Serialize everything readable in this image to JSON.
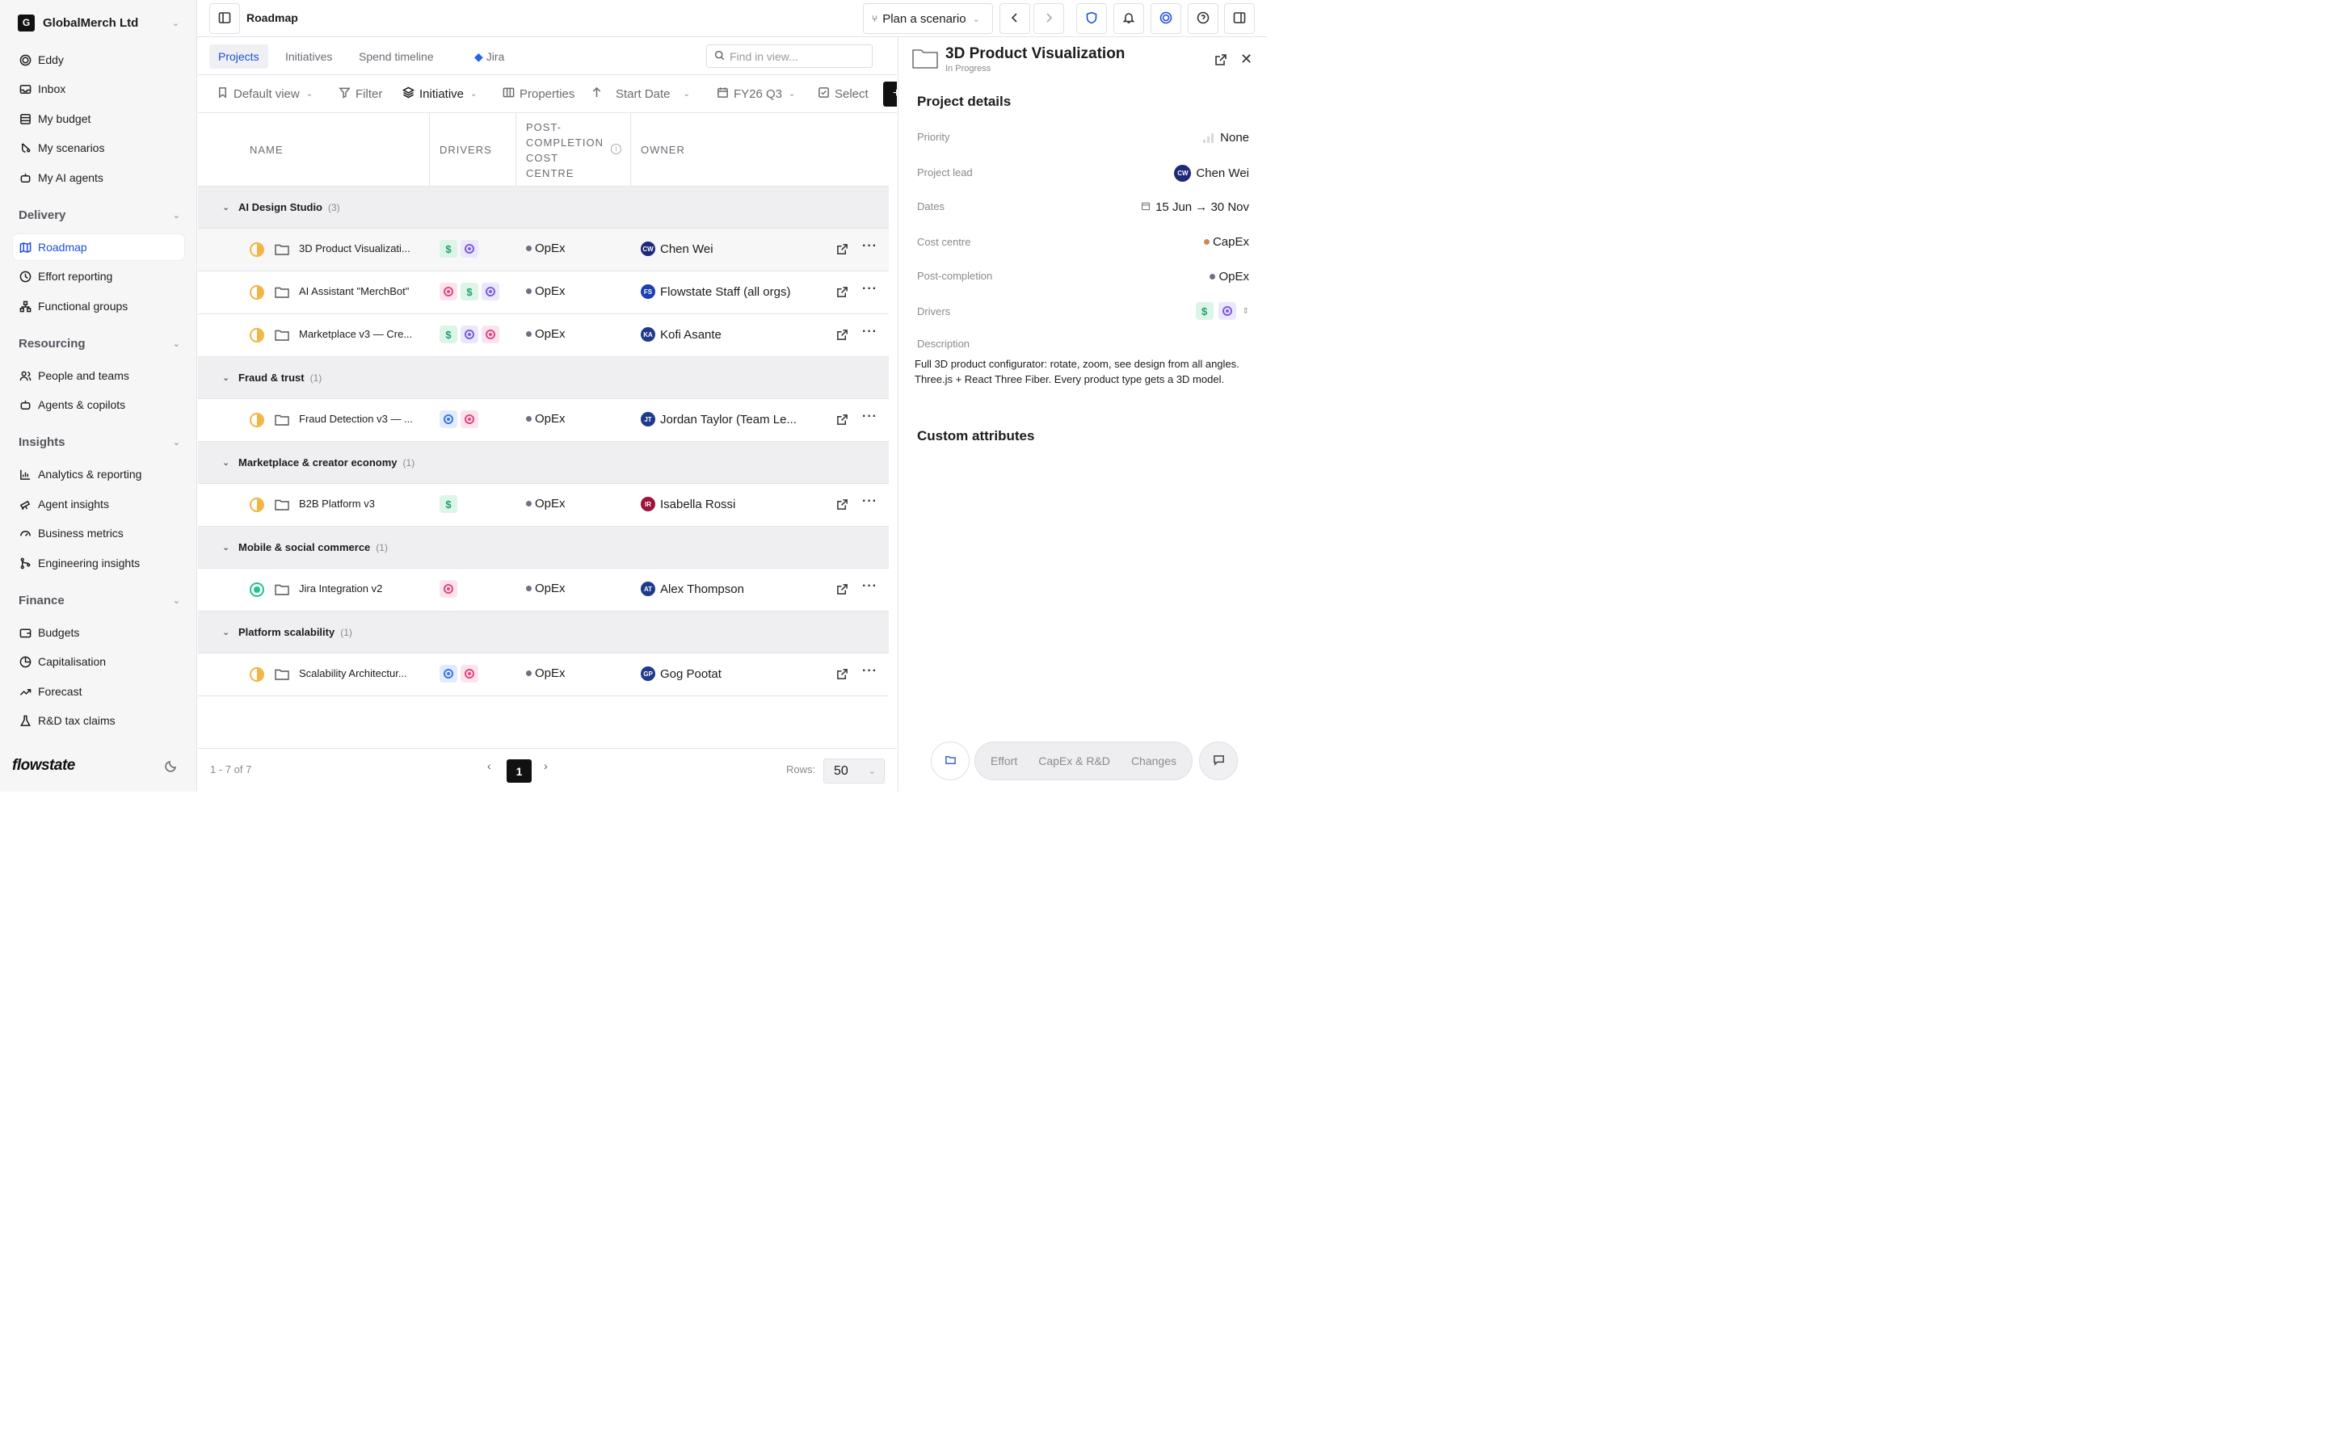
{
  "org": {
    "logo_letter": "G",
    "name": "GlobalMerch Ltd"
  },
  "nav": {
    "top": [
      "Eddy",
      "Inbox",
      "My budget",
      "My scenarios",
      "My AI agents"
    ],
    "delivery": {
      "heading": "Delivery",
      "items": [
        "Roadmap",
        "Effort reporting",
        "Functional groups"
      ]
    },
    "resourcing": {
      "heading": "Resourcing",
      "items": [
        "People and teams",
        "Agents & copilots"
      ]
    },
    "insights": {
      "heading": "Insights",
      "items": [
        "Analytics & reporting",
        "Agent insights",
        "Business metrics",
        "Engineering insights"
      ]
    },
    "finance": {
      "heading": "Finance",
      "items": [
        "Budgets",
        "Capitalisation",
        "Forecast",
        "R&D tax claims"
      ]
    }
  },
  "brand": "flowstate",
  "topbar": {
    "breadcrumb": "Roadmap",
    "plan_label": "Plan a scenario"
  },
  "tabs": [
    "Projects",
    "Initiatives",
    "Spend timeline",
    "Jira"
  ],
  "search": {
    "placeholder": "Find in view..."
  },
  "toolbar": {
    "view": "Default view",
    "filter": "Filter",
    "group": "Initiative",
    "properties": "Properties",
    "sort": "Start Date",
    "period": "FY26 Q3",
    "select": "Select"
  },
  "columns": {
    "name": "NAME",
    "drivers": "DRIVERS",
    "post": "POST-\nCOMPLETION\nCOST\nCENTRE",
    "owner": "OWNER"
  },
  "groups": [
    {
      "name": "AI Design Studio",
      "count": "(3)",
      "rows": [
        {
          "name": "3D Product Visualizati...",
          "drivers": [
            "money",
            "purple"
          ],
          "cost": "OpEx",
          "owner": "Chen Wei",
          "initials": "CW",
          "color": "#1e2a78",
          "status": "half"
        },
        {
          "name": "AI Assistant \"MerchBot\"",
          "drivers": [
            "pink",
            "money",
            "purple"
          ],
          "cost": "OpEx",
          "owner": "Flowstate Staff (all orgs)",
          "initials": "FS",
          "color": "#1e40af",
          "status": "half"
        },
        {
          "name": "Marketplace v3 — Cre...",
          "drivers": [
            "money",
            "purple",
            "pink"
          ],
          "cost": "OpEx",
          "owner": "Kofi Asante",
          "initials": "KA",
          "color": "#1e3a8a",
          "status": "half"
        }
      ]
    },
    {
      "name": "Fraud & trust",
      "count": "(1)",
      "rows": [
        {
          "name": "Fraud Detection v3 — ...",
          "drivers": [
            "blue",
            "pink"
          ],
          "cost": "OpEx",
          "owner": "Jordan Taylor (Team Le...",
          "initials": "JT",
          "color": "#1e3a8a",
          "status": "half"
        }
      ]
    },
    {
      "name": "Marketplace & creator economy",
      "count": "(1)",
      "rows": [
        {
          "name": "B2B Platform v3",
          "drivers": [
            "money"
          ],
          "cost": "OpEx",
          "owner": "Isabella Rossi",
          "initials": "IR",
          "color": "#9f1239",
          "status": "half"
        }
      ]
    },
    {
      "name": "Mobile & social commerce",
      "count": "(1)",
      "rows": [
        {
          "name": "Jira Integration v2",
          "drivers": [
            "pink"
          ],
          "cost": "OpEx",
          "owner": "Alex Thompson",
          "initials": "AT",
          "color": "#1e3a8a",
          "status": "done"
        }
      ]
    },
    {
      "name": "Platform scalability",
      "count": "(1)",
      "rows": [
        {
          "name": "Scalability Architectur...",
          "drivers": [
            "blue",
            "pink"
          ],
          "cost": "OpEx",
          "owner": "Gog Pootat",
          "initials": "GP",
          "color": "#1e3a8a",
          "status": "half"
        }
      ]
    }
  ],
  "pager": {
    "count": "1 - 7 of 7",
    "page": "1",
    "rows_label": "Rows:",
    "rows_value": "50"
  },
  "panel": {
    "title": "3D Product Visualization",
    "status": "In Progress",
    "details_heading": "Project details",
    "priority_label": "Priority",
    "priority_value": "None",
    "lead_label": "Project lead",
    "lead_value": "Chen Wei",
    "lead_initials": "CW",
    "dates_label": "Dates",
    "dates_value": "15 Jun → 30 Nov",
    "cost_label": "Cost centre",
    "cost_value": "CapEx",
    "post_label": "Post-completion",
    "post_value": "OpEx",
    "drivers_label": "Drivers",
    "desc_label": "Description",
    "description": "Full 3D product configurator: rotate, zoom, see design from all angles. Three.js + React Three Fiber. Every product type gets a 3D model.",
    "custom_heading": "Custom attributes",
    "bottom_tabs": [
      "Effort",
      "CapEx & R&D",
      "Changes"
    ]
  }
}
